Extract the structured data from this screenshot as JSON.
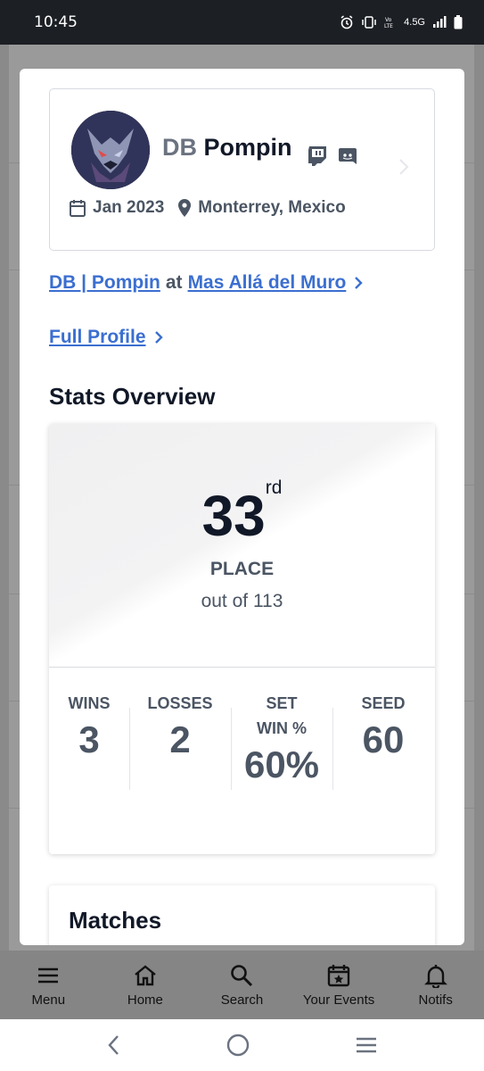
{
  "status_bar": {
    "time": "10:45",
    "network": "4.5G"
  },
  "profile": {
    "name_prefix": "DB",
    "name": "Pompin",
    "joined": "Jan 2023",
    "location": "Monterrey, Mexico"
  },
  "links": {
    "team_player": "DB | Pompin",
    "at": "at",
    "event": "Mas Allá del Muro",
    "full_profile": "Full Profile"
  },
  "stats": {
    "section_title": "Stats Overview",
    "place": "33",
    "place_suffix": "rd",
    "place_label": "PLACE",
    "out_of": "out of 113",
    "columns": [
      {
        "label": "WINS",
        "value": "3"
      },
      {
        "label": "LOSSES",
        "value": "2"
      },
      {
        "label": "SET WIN %",
        "value": "60%"
      },
      {
        "label": "SEED",
        "value": "60"
      }
    ]
  },
  "matches": {
    "title": "Matches"
  },
  "bottom_nav": [
    {
      "label": "Menu",
      "icon": "menu-icon"
    },
    {
      "label": "Home",
      "icon": "home-icon"
    },
    {
      "label": "Search",
      "icon": "search-icon"
    },
    {
      "label": "Your Events",
      "icon": "calendar-star-icon"
    },
    {
      "label": "Notifs",
      "icon": "bell-icon"
    }
  ],
  "colors": {
    "link": "#3b6fd0",
    "text_dark": "#111827",
    "text_muted": "#4b5563"
  }
}
